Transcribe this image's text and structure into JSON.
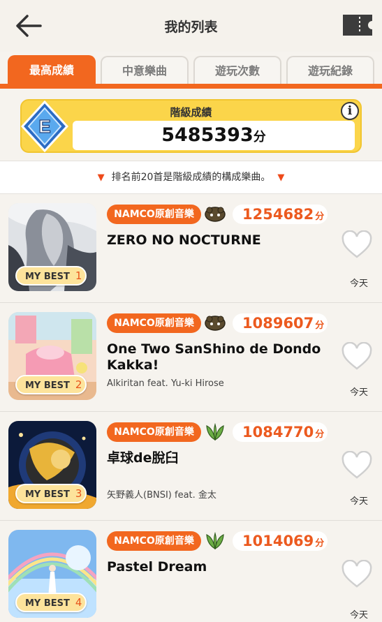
{
  "header": {
    "title": "我的列表",
    "back_icon": "arrow-left-icon",
    "ticket_icon": "ticket-icon"
  },
  "tabs": [
    {
      "label": "最高成績",
      "active": true
    },
    {
      "label": "中意樂曲",
      "active": false
    },
    {
      "label": "遊玩次數",
      "active": false
    },
    {
      "label": "遊玩紀錄",
      "active": false
    }
  ],
  "rank": {
    "label": "階級成績",
    "grade": "E",
    "score": "5485393",
    "unit": "分",
    "info": "i"
  },
  "note": "排名前20首是階級成績的構成樂曲。",
  "songs": [
    {
      "mybest_label": "MY BEST",
      "rank": "1",
      "category": "NAMCO原創音樂",
      "difficulty_icon": "oni-difficulty-icon",
      "score": "1254682",
      "unit": "分",
      "title": "ZERO NO NOCTURNE",
      "artist": "",
      "date": "今天"
    },
    {
      "mybest_label": "MY BEST",
      "rank": "2",
      "category": "NAMCO原創音樂",
      "difficulty_icon": "oni-difficulty-icon",
      "score": "1089607",
      "unit": "分",
      "title": "One Two SanShino de Dondo Kakka!",
      "artist": "Alkiritan feat. Yu-ki Hirose",
      "date": "今天"
    },
    {
      "mybest_label": "MY BEST",
      "rank": "3",
      "category": "NAMCO原創音樂",
      "difficulty_icon": "hard-difficulty-icon",
      "score": "1084770",
      "unit": "分",
      "title": "卓球de脫臼",
      "artist": "矢野義人(BNSI) feat. 金太",
      "date": "今天"
    },
    {
      "mybest_label": "MY BEST",
      "rank": "4",
      "category": "NAMCO原創音樂",
      "difficulty_icon": "hard-difficulty-icon",
      "score": "1014069",
      "unit": "分",
      "title": "Pastel Dream",
      "artist": "",
      "date": "今天"
    }
  ],
  "colors": {
    "accent": "#f2671f",
    "gold": "#fbd54a",
    "background": "#f6f3ee"
  }
}
